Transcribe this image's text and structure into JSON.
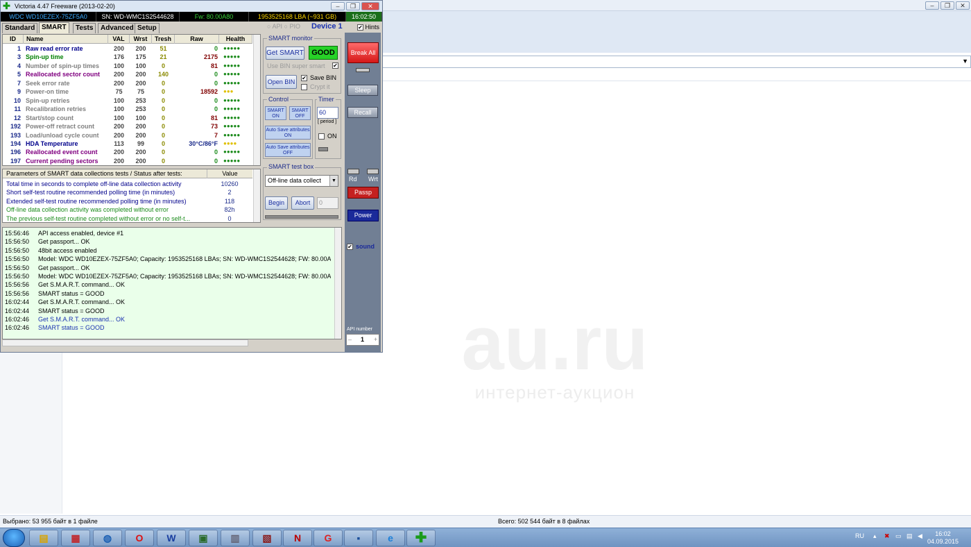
{
  "victoria": {
    "title": "Victoria 4.47  Freeware (2013-02-20)",
    "info": {
      "model": "WDC WD10EZEX-75ZF5A0",
      "serial": "SN: WD-WMC1S2544628",
      "firmware": "Fw: 80.00A80",
      "lba": "1953525168 LBA (~931 GB)",
      "clock": "16:02:50"
    },
    "tabs": [
      "Standard",
      "SMART",
      "Tests",
      "Advanced",
      "Setup"
    ],
    "active_tab": "SMART",
    "api_label": "API",
    "pio_label": "PIO",
    "device_label": "Device 1",
    "hints_label": "Hints",
    "smart_headers": [
      "ID",
      "Name",
      "VAL",
      "Wrst",
      "Tresh",
      "Raw",
      "Health"
    ],
    "smart_rows": [
      {
        "id": "1",
        "name": "Raw read error rate",
        "val": "200",
        "wrst": "200",
        "tresh": "51",
        "raw": "0",
        "health": "●●●●●",
        "color": "#00008b",
        "hcolor": "#1a8a1a"
      },
      {
        "id": "3",
        "name": "Spin-up time",
        "val": "176",
        "wrst": "175",
        "tresh": "21",
        "raw": "2175",
        "health": "●●●●●",
        "color": "#008000",
        "hcolor": "#1a8a1a"
      },
      {
        "id": "4",
        "name": "Number of spin-up times",
        "val": "100",
        "wrst": "100",
        "tresh": "0",
        "raw": "81",
        "health": "●●●●●",
        "color": "#808080",
        "hcolor": "#1a8a1a"
      },
      {
        "id": "5",
        "name": "Reallocated sector count",
        "val": "200",
        "wrst": "200",
        "tresh": "140",
        "raw": "0",
        "health": "●●●●●",
        "color": "#800080",
        "hcolor": "#1a8a1a"
      },
      {
        "id": "7",
        "name": "Seek error rate",
        "val": "200",
        "wrst": "200",
        "tresh": "0",
        "raw": "0",
        "health": "●●●●●",
        "color": "#808080",
        "hcolor": "#1a8a1a"
      },
      {
        "id": "9",
        "name": "Power-on time",
        "val": "75",
        "wrst": "75",
        "tresh": "0",
        "raw": "18592",
        "health": "●●●",
        "color": "#808080",
        "hcolor": "#e0c000"
      },
      {
        "id": "10",
        "name": "Spin-up retries",
        "val": "100",
        "wrst": "253",
        "tresh": "0",
        "raw": "0",
        "health": "●●●●●",
        "color": "#808080",
        "hcolor": "#1a8a1a"
      },
      {
        "id": "11",
        "name": "Recalibration retries",
        "val": "100",
        "wrst": "253",
        "tresh": "0",
        "raw": "0",
        "health": "●●●●●",
        "color": "#808080",
        "hcolor": "#1a8a1a"
      },
      {
        "id": "12",
        "name": "Start/stop count",
        "val": "100",
        "wrst": "100",
        "tresh": "0",
        "raw": "81",
        "health": "●●●●●",
        "color": "#808080",
        "hcolor": "#1a8a1a"
      },
      {
        "id": "192",
        "name": "Power-off retract count",
        "val": "200",
        "wrst": "200",
        "tresh": "0",
        "raw": "73",
        "health": "●●●●●",
        "color": "#808080",
        "hcolor": "#1a8a1a"
      },
      {
        "id": "193",
        "name": "Load/unload cycle count",
        "val": "200",
        "wrst": "200",
        "tresh": "0",
        "raw": "7",
        "health": "●●●●●",
        "color": "#808080",
        "hcolor": "#1a8a1a"
      },
      {
        "id": "194",
        "name": "HDA Temperature",
        "val": "113",
        "wrst": "99",
        "tresh": "0",
        "raw": "30°C/86°F",
        "health": "●●●●",
        "color": "#00008b",
        "hcolor": "#e0c000"
      },
      {
        "id": "196",
        "name": "Reallocated event count",
        "val": "200",
        "wrst": "200",
        "tresh": "0",
        "raw": "0",
        "health": "●●●●●",
        "color": "#800080",
        "hcolor": "#1a8a1a"
      },
      {
        "id": "197",
        "name": "Current pending sectors",
        "val": "200",
        "wrst": "200",
        "tresh": "0",
        "raw": "0",
        "health": "●●●●●",
        "color": "#800080",
        "hcolor": "#1a8a1a"
      }
    ],
    "params_header": "Parameters of SMART data collections tests / Status after tests:",
    "params_value_header": "Value",
    "params_rows": [
      {
        "text": "Total time in seconds to complete off-line data collection activity",
        "value": "10260",
        "color": "#00008b"
      },
      {
        "text": "Short self-test routine recommended polling time (in minutes)",
        "value": "2",
        "color": "#00008b"
      },
      {
        "text": "Extended self-test routine recommended polling time (in minutes)",
        "value": "118",
        "color": "#00008b"
      },
      {
        "text": "Off-line data collection activity was completed without error",
        "value": "82h",
        "color": "#1a8a1a"
      },
      {
        "text": "The previous self-test routine completed without error or no self-t...",
        "value": "0",
        "color": "#1a8a1a"
      }
    ],
    "log": [
      {
        "time": "15:56:46",
        "msg": "API access enabled, device #1",
        "color": "#000000"
      },
      {
        "time": "15:56:50",
        "msg": "Get passport... OK",
        "color": "#000000"
      },
      {
        "time": "15:56:50",
        "msg": "48bit access enabled",
        "color": "#000000"
      },
      {
        "time": "15:56:50",
        "msg": "Model: WDC WD10EZEX-75ZF5A0; Capacity: 1953525168 LBAs; SN: WD-WMC1S2544628; FW: 80.00A80",
        "color": "#000000"
      },
      {
        "time": "15:56:50",
        "msg": "Get passport... OK",
        "color": "#000000"
      },
      {
        "time": "15:56:50",
        "msg": "Model: WDC WD10EZEX-75ZF5A0; Capacity: 1953525168 LBAs; SN: WD-WMC1S2544628; FW: 80.00A80",
        "color": "#000000"
      },
      {
        "time": "15:56:56",
        "msg": "Get S.M.A.R.T. command... OK",
        "color": "#000000"
      },
      {
        "time": "15:56:56",
        "msg": "SMART status = GOOD",
        "color": "#000000"
      },
      {
        "time": "16:02:44",
        "msg": "Get S.M.A.R.T. command... OK",
        "color": "#000000"
      },
      {
        "time": "16:02:44",
        "msg": "SMART status = GOOD",
        "color": "#000000"
      },
      {
        "time": "16:02:46",
        "msg": "Get S.M.A.R.T. command... OK",
        "color": "#1a31b0"
      },
      {
        "time": "16:02:46",
        "msg": "SMART status = GOOD",
        "color": "#1a31b0"
      }
    ],
    "smart_monitor": {
      "label": "SMART monitor",
      "get_smart": "Get SMART",
      "status": "GOOD",
      "use_bin": "Use BIN super smart",
      "open_bin": "Open BIN",
      "save_bin": "Save BIN",
      "crypt": "Crypt it"
    },
    "control": {
      "label": "Control",
      "smart_on": "SMART ON",
      "smart_off": "SMART OFF",
      "auto_save_on": "Auto Save attributes ON",
      "auto_save_off": "Auto Save attributes OFF"
    },
    "timer": {
      "label": "Timer",
      "value": "60",
      "period": "[ period ]",
      "on_label": "ON"
    },
    "test_box": {
      "label": "SMART test box",
      "selected": "Off-line data collect",
      "begin": "Begin",
      "abort": "Abort",
      "value": "0"
    },
    "sidebar": {
      "break_all": "Break All",
      "sleep": "Sleep",
      "recall": "Recall",
      "rd": "Rd",
      "wrt": "Wrt",
      "passp": "Passp",
      "power": "Power",
      "sound": "sound",
      "api_number_label": "API number",
      "api_number": "1"
    }
  },
  "explorer": {
    "status_left": "Выбрано: 53 955 байт в 1 файле",
    "status_mid": "Всего: 502 544 байт в 8 файлах"
  },
  "watermark": {
    "big": "au.ru",
    "small": "интернет-аукцион"
  },
  "taskbar": {
    "lang": "RU",
    "time": "16:02",
    "date": "04.09.2015"
  }
}
